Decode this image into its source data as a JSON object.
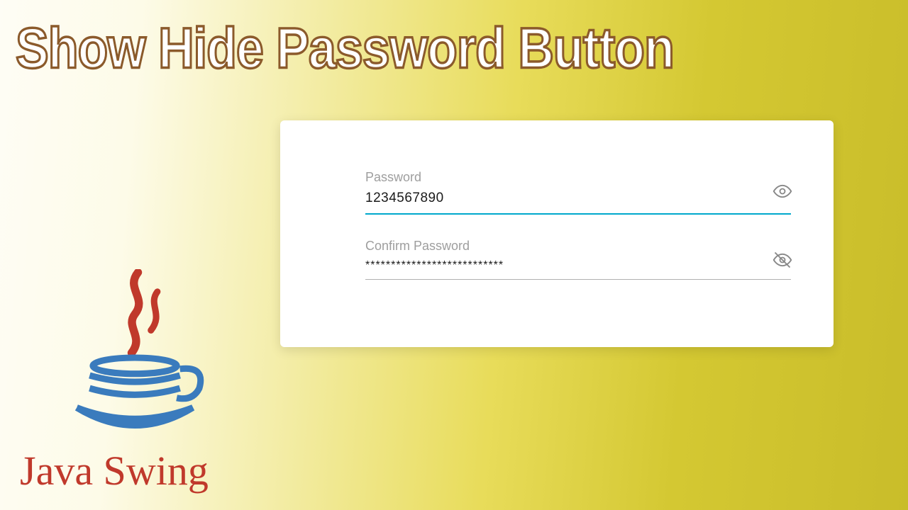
{
  "title": "Show Hide Password Button",
  "form": {
    "password": {
      "label": "Password",
      "value": "1234567890",
      "visible": true
    },
    "confirm": {
      "label": "Confirm Password",
      "value": "***************************",
      "visible": false
    }
  },
  "footer": "Java Swing"
}
